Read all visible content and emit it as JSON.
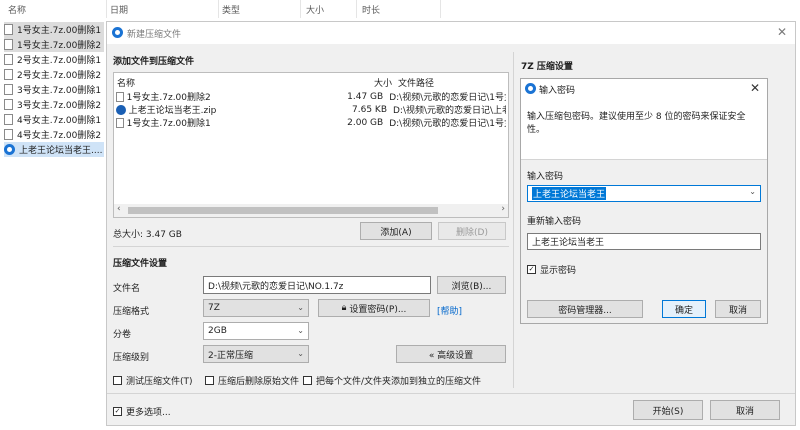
{
  "explorer": {
    "columns": [
      "名称",
      "日期",
      "类型",
      "大小",
      "时长"
    ],
    "files": [
      {
        "name": "1号女主.7z.00删除1",
        "state": "dim"
      },
      {
        "name": "1号女主.7z.00删除2",
        "state": "dim"
      },
      {
        "name": "2号女主.7z.00删除1",
        "state": "normal"
      },
      {
        "name": "2号女主.7z.00删除2",
        "state": "normal"
      },
      {
        "name": "3号女主.7z.00删除1",
        "state": "normal"
      },
      {
        "name": "3号女主.7z.00删除2",
        "state": "normal"
      },
      {
        "name": "4号女主.7z.00删除1",
        "state": "normal"
      },
      {
        "name": "4号女主.7z.00删除2",
        "state": "normal"
      },
      {
        "name": "上老王论坛当老王....",
        "state": "selected"
      }
    ]
  },
  "dialog": {
    "title": "新建压缩文件",
    "add_section": "添加文件到压缩文件",
    "list_headers": {
      "name": "名称",
      "size": "大小",
      "path": "文件路径"
    },
    "rows": [
      {
        "name": "1号女主.7z.00删除2",
        "size": "1.47 GB",
        "path": "D:\\视频\\元歌的恋爱日记\\1号女"
      },
      {
        "name": "上老王论坛当老王.zip",
        "size": "7.65 KB",
        "path": "D:\\视频\\元歌的恋爱日记\\上老"
      },
      {
        "name": "1号女主.7z.00删除1",
        "size": "2.00 GB",
        "path": "D:\\视频\\元歌的恋爱日记\\1号女"
      }
    ],
    "total_size": "总大小: 3.47 GB",
    "add_button": "添加(A)",
    "delete_button": "删除(D)",
    "settings_section": "压缩文件设置",
    "filename_label": "文件名",
    "filename_value": "D:\\视频\\元歌的恋爱日记\\NO.1.7z",
    "browse_button": "浏览(B)...",
    "format_label": "压缩格式",
    "format_value": "7Z",
    "set_password_button": "设置密码(P)...",
    "help_link": "[帮助]",
    "split_label": "分卷",
    "split_value": "2GB",
    "level_label": "压缩级别",
    "level_value": "2-正常压缩",
    "advanced_button": "« 高级设置",
    "opt_test": "测试压缩文件(T)",
    "opt_delete": "压缩后删除原始文件",
    "opt_separate": "把每个文件/文件夹添加到独立的压缩文件",
    "more_options": "更多选项...",
    "start_button": "开始(S)",
    "cancel_button": "取消",
    "right_title": "7Z 压缩设置"
  },
  "password_dialog": {
    "title": "输入密码",
    "instruction": "输入压缩包密码。建议使用至少 8 位的密码来保证安全性。",
    "password_label": "输入密码",
    "password_value": "上老王论坛当老王",
    "reenter_label": "重新输入密码",
    "reenter_value": "上老王论坛当老王",
    "show_password": "显示密码",
    "show_password_checked": true,
    "manager_button": "密码管理器...",
    "ok_button": "确定",
    "cancel_button": "取消"
  },
  "colors": {
    "accent": "#0078d7",
    "selection": "#0078d7"
  }
}
